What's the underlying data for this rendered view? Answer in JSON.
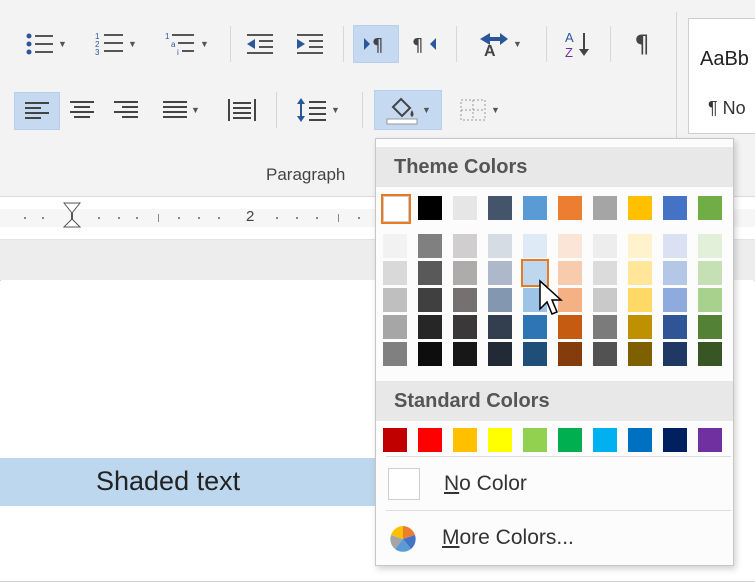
{
  "ribbon": {
    "group_label": "Paragraph",
    "styles_sample": "AaBb",
    "styles_sample2": "¶ No",
    "pilcrow": "¶",
    "sort": "A↓"
  },
  "ruler": {
    "number": "2"
  },
  "document": {
    "shaded_text": "Shaded text"
  },
  "menu": {
    "theme_header": "Theme Colors",
    "standard_header": "Standard Colors",
    "no_color_label": "No Color",
    "more_colors_label": "More Colors...",
    "theme_top": [
      "#ffffff",
      "#000000",
      "#e7e6e6",
      "#44546a",
      "#5b9bd5",
      "#ed7d31",
      "#a5a5a5",
      "#ffc000",
      "#4472c4",
      "#70ad47"
    ],
    "theme_shades": [
      [
        "#f2f2f2",
        "#d9d9d9",
        "#bfbfbf",
        "#a6a6a6",
        "#808080"
      ],
      [
        "#808080",
        "#595959",
        "#404040",
        "#262626",
        "#0d0d0d"
      ],
      [
        "#d0cece",
        "#aeabab",
        "#767171",
        "#3a3838",
        "#171717"
      ],
      [
        "#d6dce4",
        "#adb9ca",
        "#8497b0",
        "#333f4f",
        "#222a35"
      ],
      [
        "#deebf7",
        "#bdd7ee",
        "#9dc3e6",
        "#2e75b6",
        "#1f4e79"
      ],
      [
        "#fbe5d6",
        "#f8cbad",
        "#f4b183",
        "#c55a11",
        "#843c0c"
      ],
      [
        "#ededed",
        "#dbdbdb",
        "#c9c9c9",
        "#7b7b7b",
        "#525252"
      ],
      [
        "#fff2cc",
        "#ffe699",
        "#ffd966",
        "#bf9000",
        "#7f6000"
      ],
      [
        "#d9e1f2",
        "#b4c7e7",
        "#8faadc",
        "#2f5597",
        "#203864"
      ],
      [
        "#e2f0d9",
        "#c5e0b4",
        "#a9d18e",
        "#538135",
        "#375623"
      ]
    ],
    "standard": [
      "#c00000",
      "#ff0000",
      "#ffc000",
      "#ffff00",
      "#92d050",
      "#00b050",
      "#00b0f0",
      "#0070c0",
      "#002060",
      "#7030a0"
    ],
    "selected_top_index": 0,
    "hover_shade": {
      "column": 4,
      "row": 1
    }
  }
}
